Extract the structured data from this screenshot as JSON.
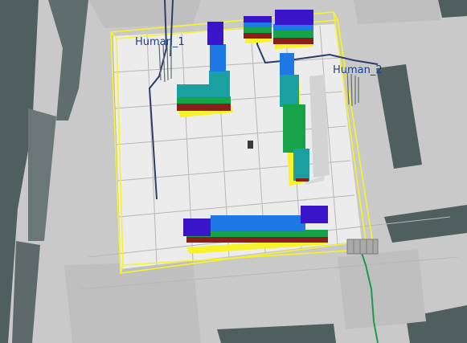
{
  "scene": {
    "type": "rviz-3d-occupancy-view",
    "colors": {
      "background": "#c9c9c9",
      "map_wall": "#4f5f5e",
      "map_free": "#ececec",
      "grid": "#b7b7b7",
      "bounds": "#f7f22a",
      "path": "#2b3f6b",
      "green_path": "#1b9a4d",
      "voxel_low": "#8b1d1d",
      "voxel_mid_1": "#17a34a",
      "voxel_mid_2": "#1aa0a0",
      "voxel_high_1": "#1e78e6",
      "voxel_high_2": "#3a14c8"
    }
  },
  "labels": {
    "human1": "Human_1",
    "human2": "Human_2"
  }
}
